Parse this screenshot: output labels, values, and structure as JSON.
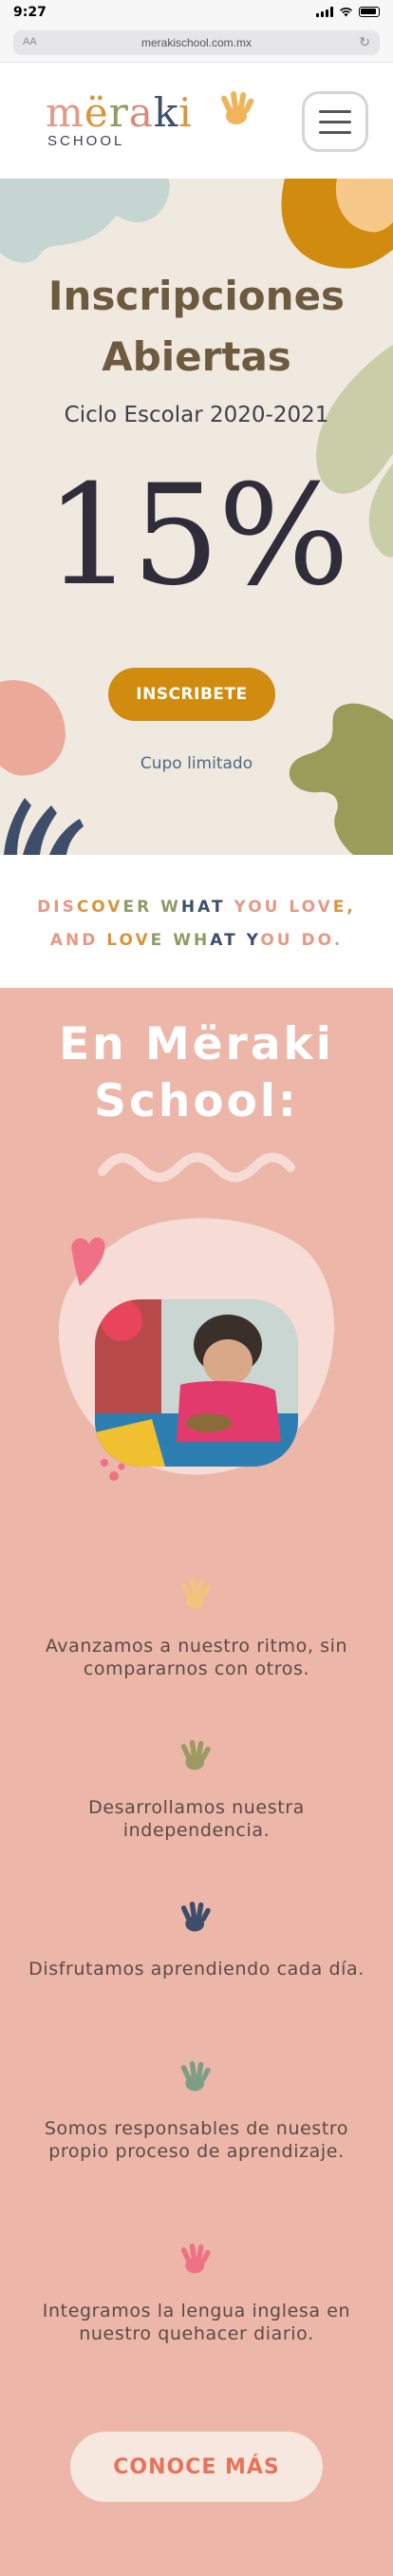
{
  "status_bar": {
    "time": "9:27"
  },
  "browser": {
    "aa_label": "AA",
    "url": "merakischool.com.mx"
  },
  "header": {
    "logo_letters": [
      {
        "char": "m",
        "color": "#e39a86"
      },
      {
        "char": "ë",
        "color": "#d8953a"
      },
      {
        "char": "r",
        "color": "#8e9c63"
      },
      {
        "char": "a",
        "color": "#d78c7a"
      },
      {
        "char": "k",
        "color": "#3e4e6a"
      },
      {
        "char": "i",
        "color": "#d8953a"
      }
    ],
    "logo_sub": "SCHOOL",
    "hand_icon_color": "#f0b45a"
  },
  "hero": {
    "title_line1": "Inscripciones",
    "title_line2": "Abiertas",
    "subtitle": "Ciclo Escolar 2020-2021",
    "discount": "15%",
    "cta_label": "INSCRIBETE",
    "note": "Cupo limitado"
  },
  "tagline": {
    "line1": "DISCOVER WHAT YOU LOVE,",
    "line2": "AND LOVE WHAT YOU DO.",
    "colors": [
      "#e39a86",
      "#d8953a",
      "#8e9c63",
      "#3e4e6a",
      "#e39a86"
    ]
  },
  "about": {
    "title_line1": "En Mëraki",
    "title_line2": "School:",
    "features": [
      {
        "text": "Avanzamos a nuestro ritmo, sin compararnos con otros.",
        "icon_color": "#f3c37e"
      },
      {
        "text": "Desarrollamos nuestra independencia.",
        "icon_color": "#9a9a62"
      },
      {
        "text": "Disfrutamos aprendiendo cada día.",
        "icon_color": "#3e4e6a"
      },
      {
        "text": "Somos responsables de nuestro propio proceso de aprendizaje.",
        "icon_color": "#7d9e85"
      },
      {
        "text": "Integramos la lengua inglesa en nuestro quehacer diario.",
        "icon_color": "#ef7185"
      }
    ],
    "button_label": "CONOCE MÁS"
  }
}
